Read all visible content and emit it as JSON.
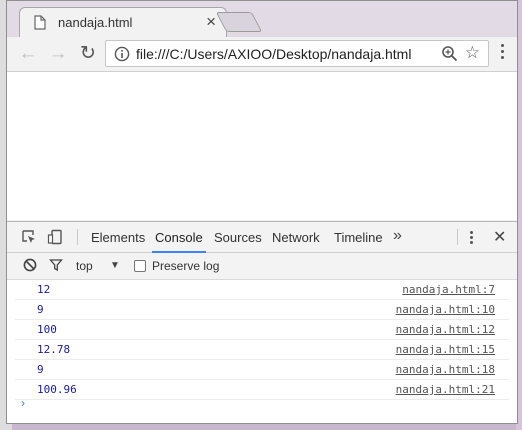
{
  "tab": {
    "title": "nandaja.html",
    "close": "×"
  },
  "toolbar": {
    "back": "←",
    "forward": "→",
    "reload": "↻",
    "url": "file:///C:/Users/AXIOO/Desktop/nandaja.html",
    "star": "☆"
  },
  "devtools": {
    "tabs": [
      "Elements",
      "Console",
      "Sources",
      "Network",
      "Timeline"
    ],
    "active_tab": "Console",
    "more": "»",
    "close": "✕"
  },
  "console": {
    "context": "top",
    "caret": "▼",
    "preserve_label": "Preserve log",
    "prompt": "›",
    "messages": [
      {
        "value": "12",
        "source": "nandaja.html:7"
      },
      {
        "value": "9",
        "source": "nandaja.html:10"
      },
      {
        "value": "100",
        "source": "nandaja.html:12"
      },
      {
        "value": "12.78",
        "source": "nandaja.html:15"
      },
      {
        "value": "9",
        "source": "nandaja.html:18"
      },
      {
        "value": "100.96",
        "source": "nandaja.html:21"
      }
    ]
  }
}
